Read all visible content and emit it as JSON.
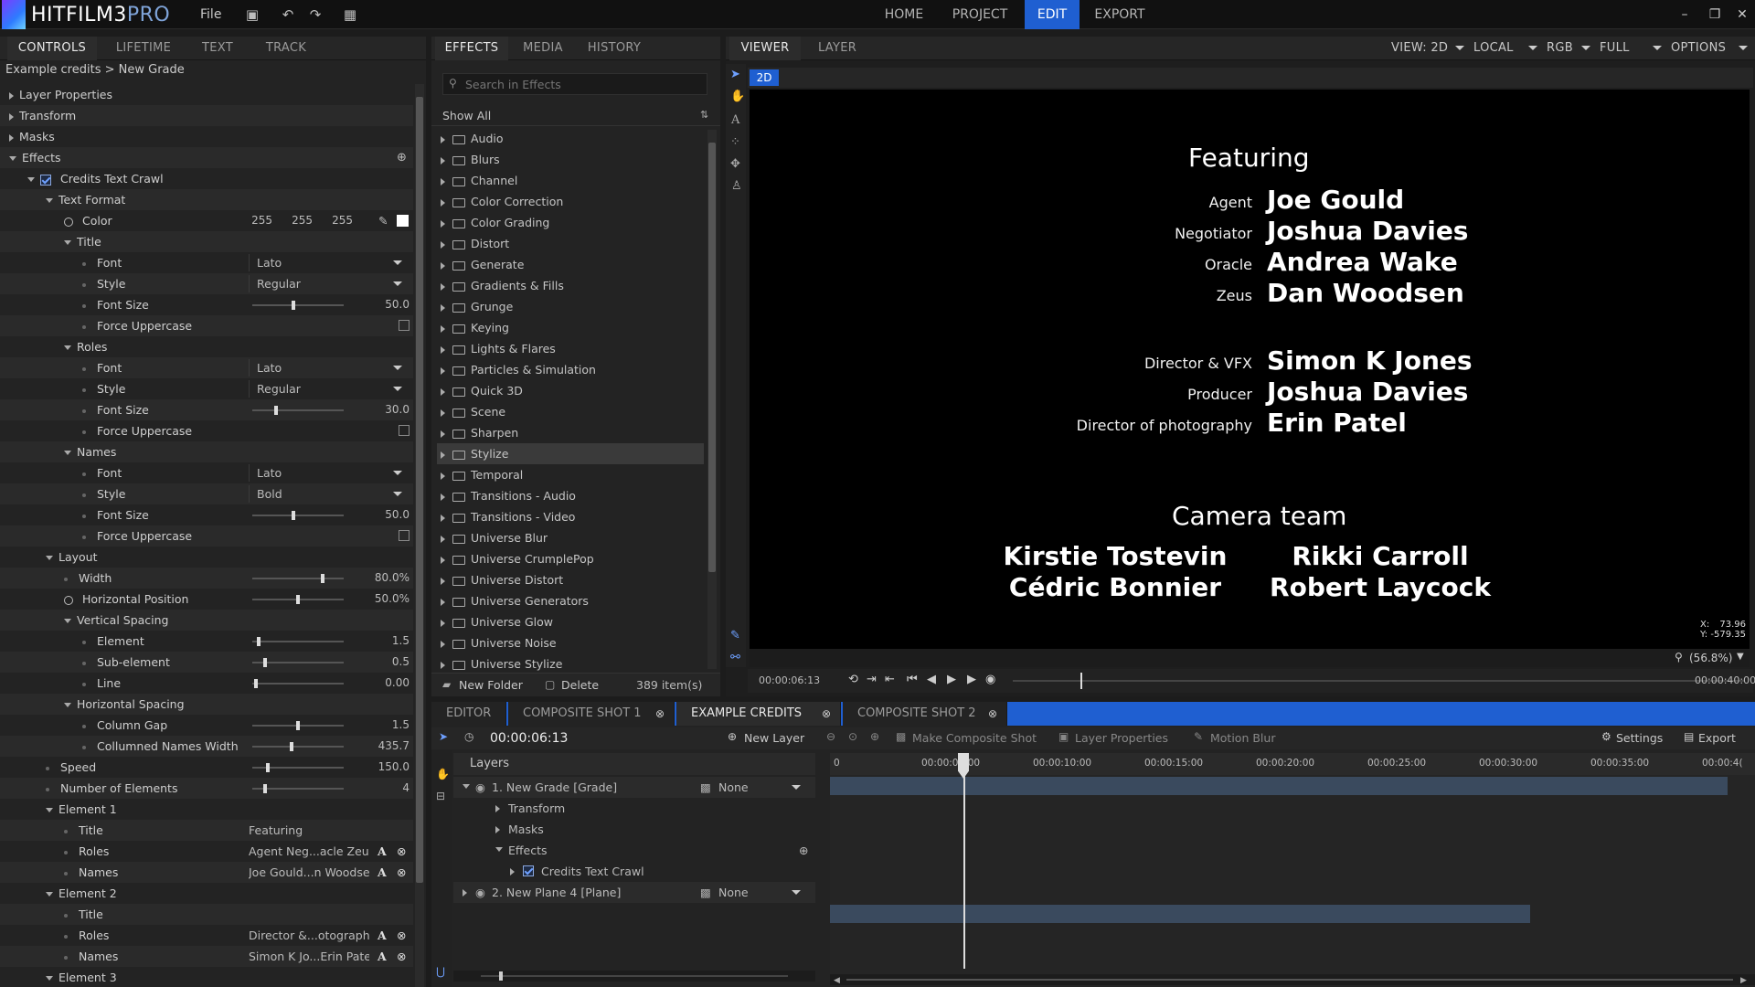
{
  "app": {
    "logo_main": "HITFILM3",
    "logo_pro": "PRO",
    "file_menu": "File"
  },
  "nav": [
    "HOME",
    "PROJECT",
    "EDIT",
    "EXPORT"
  ],
  "controls_panel": {
    "tabs": [
      "CONTROLS",
      "LIFETIME",
      "TEXT",
      "TRACK"
    ],
    "breadcrumb": "Example credits > New Grade",
    "rows": [
      {
        "label": "Layer Properties",
        "indent": 0,
        "kind": "group",
        "open": false
      },
      {
        "label": "Transform",
        "indent": 0,
        "kind": "group",
        "open": false
      },
      {
        "label": "Masks",
        "indent": 0,
        "kind": "group",
        "open": false
      },
      {
        "label": "Effects",
        "indent": 0,
        "kind": "group",
        "open": true,
        "add": true
      },
      {
        "label": "Credits Text Crawl",
        "indent": 1,
        "kind": "effect",
        "open": true
      },
      {
        "label": "Text Format",
        "indent": 2,
        "kind": "group",
        "open": true
      },
      {
        "label": "Color",
        "indent": 3,
        "kind": "color",
        "r": "255",
        "g": "255",
        "b": "255"
      },
      {
        "label": "Title",
        "indent": 3,
        "kind": "group",
        "open": true
      },
      {
        "label": "Font",
        "indent": 4,
        "kind": "dropdown",
        "value": "Lato"
      },
      {
        "label": "Style",
        "indent": 4,
        "kind": "dropdown",
        "value": "Regular"
      },
      {
        "label": "Font Size",
        "indent": 4,
        "kind": "slider",
        "value": "50.0",
        "pos": 0.45
      },
      {
        "label": "Force Uppercase",
        "indent": 4,
        "kind": "check"
      },
      {
        "label": "Roles",
        "indent": 3,
        "kind": "group",
        "open": true
      },
      {
        "label": "Font",
        "indent": 4,
        "kind": "dropdown",
        "value": "Lato"
      },
      {
        "label": "Style",
        "indent": 4,
        "kind": "dropdown",
        "value": "Regular"
      },
      {
        "label": "Font Size",
        "indent": 4,
        "kind": "slider",
        "value": "30.0",
        "pos": 0.25
      },
      {
        "label": "Force Uppercase",
        "indent": 4,
        "kind": "check"
      },
      {
        "label": "Names",
        "indent": 3,
        "kind": "group",
        "open": true
      },
      {
        "label": "Font",
        "indent": 4,
        "kind": "dropdown",
        "value": "Lato"
      },
      {
        "label": "Style",
        "indent": 4,
        "kind": "dropdown",
        "value": "Bold"
      },
      {
        "label": "Font Size",
        "indent": 4,
        "kind": "slider",
        "value": "50.0",
        "pos": 0.45
      },
      {
        "label": "Force Uppercase",
        "indent": 4,
        "kind": "check"
      },
      {
        "label": "Layout",
        "indent": 2,
        "kind": "group",
        "open": true
      },
      {
        "label": "Width",
        "indent": 3,
        "kind": "slider",
        "value": "80.0%",
        "pos": 0.78
      },
      {
        "label": "Horizontal Position",
        "indent": 3,
        "kind": "slider",
        "value": "50.0%",
        "pos": 0.5,
        "ring": true
      },
      {
        "label": "Vertical Spacing",
        "indent": 3,
        "kind": "group",
        "open": true
      },
      {
        "label": "Element",
        "indent": 4,
        "kind": "slider",
        "value": "1.5",
        "pos": 0.05
      },
      {
        "label": "Sub-element",
        "indent": 4,
        "kind": "slider",
        "value": "0.5",
        "pos": 0.12
      },
      {
        "label": "Line",
        "indent": 4,
        "kind": "slider",
        "value": "0.00",
        "pos": 0.02
      },
      {
        "label": "Horizontal Spacing",
        "indent": 3,
        "kind": "group",
        "open": true
      },
      {
        "label": "Column Gap",
        "indent": 4,
        "kind": "slider",
        "value": "1.5",
        "pos": 0.5
      },
      {
        "label": "Collumned Names Width",
        "indent": 4,
        "kind": "slider",
        "value": "435.7",
        "pos": 0.43
      },
      {
        "label": "Speed",
        "indent": 2,
        "kind": "slider",
        "value": "150.0",
        "pos": 0.16
      },
      {
        "label": "Number of Elements",
        "indent": 2,
        "kind": "slider",
        "value": "4",
        "pos": 0.12
      },
      {
        "label": "Element 1",
        "indent": 2,
        "kind": "group",
        "open": true
      },
      {
        "label": "Title",
        "indent": 3,
        "kind": "text",
        "value": "Featuring"
      },
      {
        "label": "Roles",
        "indent": 3,
        "kind": "text",
        "value": "Agent Neg...acle Zeus",
        "btns": true
      },
      {
        "label": "Names",
        "indent": 3,
        "kind": "text",
        "value": "Joe Gould...n Woodsen",
        "btns": true
      },
      {
        "label": "Element 2",
        "indent": 2,
        "kind": "group",
        "open": true
      },
      {
        "label": "Title",
        "indent": 3,
        "kind": "text",
        "value": ""
      },
      {
        "label": "Roles",
        "indent": 3,
        "kind": "text",
        "value": "Director &...otography",
        "btns": true
      },
      {
        "label": "Names",
        "indent": 3,
        "kind": "text",
        "value": "Simon K Jo...Erin Patel",
        "btns": true
      },
      {
        "label": "Element 3",
        "indent": 2,
        "kind": "group",
        "open": true
      }
    ]
  },
  "effects_panel": {
    "tabs": [
      "EFFECTS",
      "MEDIA",
      "HISTORY"
    ],
    "search_placeholder": "Search in Effects",
    "filter": "Show All",
    "folders": [
      "Audio",
      "Blurs",
      "Channel",
      "Color Correction",
      "Color Grading",
      "Distort",
      "Generate",
      "Gradients & Fills",
      "Grunge",
      "Keying",
      "Lights & Flares",
      "Particles & Simulation",
      "Quick 3D",
      "Scene",
      "Sharpen",
      "Stylize",
      "Temporal",
      "Transitions - Audio",
      "Transitions - Video",
      "Universe Blur",
      "Universe CrumplePop",
      "Universe Distort",
      "Universe Generators",
      "Universe Glow",
      "Universe Noise",
      "Universe Stylize"
    ],
    "selected": "Stylize",
    "new_folder": "New Folder",
    "delete": "Delete",
    "count": "389 item(s)"
  },
  "viewer_panel": {
    "tabs": [
      "VIEWER",
      "LAYER"
    ],
    "options": [
      "VIEW: 2D",
      "LOCAL",
      "RGB",
      "FULL",
      "OPTIONS"
    ],
    "badge": "2D",
    "coords": {
      "x_label": "X:",
      "x": "73.96",
      "y_label": "Y:",
      "y": "-579.35"
    },
    "zoom": "(56.8%)",
    "time_start": "00:00:06:13",
    "time_end": "00:00:40:00",
    "credits": {
      "featuring": "Featuring",
      "block1": [
        [
          "Agent",
          "Joe Gould"
        ],
        [
          "Negotiator",
          "Joshua Davies"
        ],
        [
          "Oracle",
          "Andrea Wake"
        ],
        [
          "Zeus",
          "Dan Woodsen"
        ]
      ],
      "block2": [
        [
          "Director & VFX",
          "Simon K Jones"
        ],
        [
          "Producer",
          "Joshua Davies"
        ],
        [
          "Director of photography",
          "Erin Patel"
        ]
      ],
      "camera_team": "Camera team",
      "camera_left": [
        "Kirstie Tostevin",
        "Cédric Bonnier"
      ],
      "camera_right": [
        "Rikki Carroll",
        "Robert Laycock"
      ]
    }
  },
  "timeline": {
    "tabs": [
      "EDITOR",
      "COMPOSITE SHOT 1",
      "EXAMPLE CREDITS",
      "COMPOSITE SHOT 2"
    ],
    "active_tab": "EXAMPLE CREDITS",
    "timecode": "00:00:06:13",
    "new_layer": "New Layer",
    "make_composite": "Make Composite Shot",
    "layer_properties": "Layer Properties",
    "motion_blur": "Motion Blur",
    "settings": "Settings",
    "export": "Export",
    "layers_label": "Layers",
    "ruler": [
      "0",
      "00:00:05:00",
      "00:00:10:00",
      "00:00:15:00",
      "00:00:20:00",
      "00:00:25:00",
      "00:00:30:00",
      "00:00:35:00",
      "00:00:4("
    ],
    "layers": [
      {
        "label": "1. New Grade [Grade]",
        "blend": "None",
        "indent": 0,
        "has_blend": true
      },
      {
        "label": "Transform",
        "indent": 1
      },
      {
        "label": "Masks",
        "indent": 1
      },
      {
        "label": "Effects",
        "indent": 1,
        "open": true
      },
      {
        "label": "Credits Text Crawl",
        "indent": 2,
        "check": true
      },
      {
        "label": "2. New Plane 4 [Plane]",
        "blend": "None",
        "indent": 0,
        "has_blend": true
      }
    ]
  }
}
